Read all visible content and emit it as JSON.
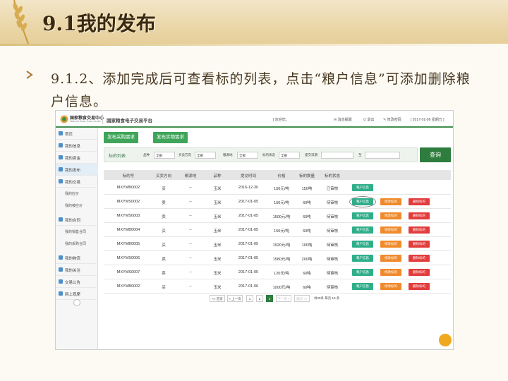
{
  "slide": {
    "title": "9.1我的发布",
    "bullet": "9.1.2、添加完成后可查看标的列表，点击“粮户信息”可添加删除粮户信息。"
  },
  "app": {
    "logo_text": "国家粮食交易中心",
    "logo_sub": "National Grain Trade Center",
    "platform": "国家粮食电子交易平台",
    "welcome": "[ 欢迎您，",
    "messages": "消息提醒",
    "logout": "退出",
    "change_password": "修改密码",
    "date": "[ 2017-01-06 星期五 ]"
  },
  "sidebar": {
    "items": [
      {
        "label": "首页"
      },
      {
        "label": "我的信息"
      },
      {
        "label": "我的资金"
      },
      {
        "label": "我的发布"
      },
      {
        "label": "我的交易"
      },
      {
        "label": "我的合同"
      },
      {
        "label": "我的物流"
      },
      {
        "label": "我的关注"
      },
      {
        "label": "交易公告"
      },
      {
        "label": "网上观摩"
      }
    ],
    "sub_trade": [
      "我的应价",
      "我的被应价"
    ],
    "sub_contract": [
      "我的销售合同",
      "我的采购合同"
    ]
  },
  "actions": {
    "buy_label": "发布采购需求",
    "sell_label": "发布实物需求"
  },
  "filter": {
    "title": "标的列表",
    "labels": [
      "品种",
      "买卖方向",
      "粮源地",
      "标的状态",
      "提交日期",
      "至"
    ],
    "values": [
      "全部",
      "全部",
      "全部",
      "全部",
      "",
      ""
    ],
    "search_label": "查询"
  },
  "table": {
    "headers": [
      "标的号",
      "买卖方向",
      "粮源地",
      "品种",
      "提交时间",
      "价格",
      "标的数量",
      "标的状态"
    ],
    "rows": [
      {
        "id": "MXYMB0002",
        "dir": "买",
        "origin": "--",
        "kind": "玉米",
        "date": "2016-12-30",
        "price": "150元/吨",
        "qty": "150吨",
        "status": "已审核",
        "actions": [
          "粮户信息"
        ]
      },
      {
        "id": "MXYMS0002",
        "dir": "卖",
        "origin": "--",
        "kind": "玉米",
        "date": "2017-01-05",
        "price": "150元/吨",
        "qty": "60吨",
        "status": "待审核",
        "actions": [
          "粮户信息",
          "修改标的",
          "删除标的"
        ]
      },
      {
        "id": "MXYMS0003",
        "dir": "卖",
        "origin": "--",
        "kind": "玉米",
        "date": "2017-01-05",
        "price": "1500元/吨",
        "qty": "60吨",
        "status": "待审核",
        "actions": [
          "粮户信息",
          "修改标的",
          "删除标的"
        ]
      },
      {
        "id": "MXYMB0004",
        "dir": "买",
        "origin": "--",
        "kind": "玉米",
        "date": "2017-01-05",
        "price": "150元/吨",
        "qty": "60吨",
        "status": "待审核",
        "actions": [
          "粮户信息",
          "修改标的",
          "删除标的"
        ]
      },
      {
        "id": "MXYMB0005",
        "dir": "买",
        "origin": "--",
        "kind": "玉米",
        "date": "2017-01-05",
        "price": "1920元/吨",
        "qty": "100吨",
        "status": "待审核",
        "actions": [
          "粮户信息",
          "修改标的",
          "删除标的"
        ]
      },
      {
        "id": "MXYMS0006",
        "dir": "卖",
        "origin": "--",
        "kind": "玉米",
        "date": "2017-01-05",
        "price": "1580元/吨",
        "qty": "200吨",
        "status": "待审核",
        "actions": [
          "粮户信息",
          "修改标的",
          "删除标的"
        ]
      },
      {
        "id": "MXYMS0007",
        "dir": "卖",
        "origin": "--",
        "kind": "玉米",
        "date": "2017-01-05",
        "price": "120元/吨",
        "qty": "60吨",
        "status": "待审核",
        "actions": [
          "粮户信息",
          "修改标的",
          "删除标的"
        ]
      },
      {
        "id": "MXYMB0002",
        "dir": "买",
        "origin": "--",
        "kind": "玉米",
        "date": "2017-01-06",
        "price": "1000元/吨",
        "qty": "60吨",
        "status": "待审核",
        "actions": [
          "粮户信息",
          "修改标的",
          "删除标的"
        ]
      }
    ]
  },
  "pagination": {
    "first": "<< 首页",
    "prev": "< 上一页",
    "pages": [
      "1",
      "2",
      "3"
    ],
    "current": "3",
    "next": "下一页 >",
    "last": "尾页 >>",
    "info": "共28条 每页 10 条"
  },
  "colors": {
    "green": "#3fa55a",
    "dark_green": "#2f7d3e",
    "teal": "#2fae8a",
    "orange": "#f08a2a",
    "red": "#e23c3c"
  }
}
